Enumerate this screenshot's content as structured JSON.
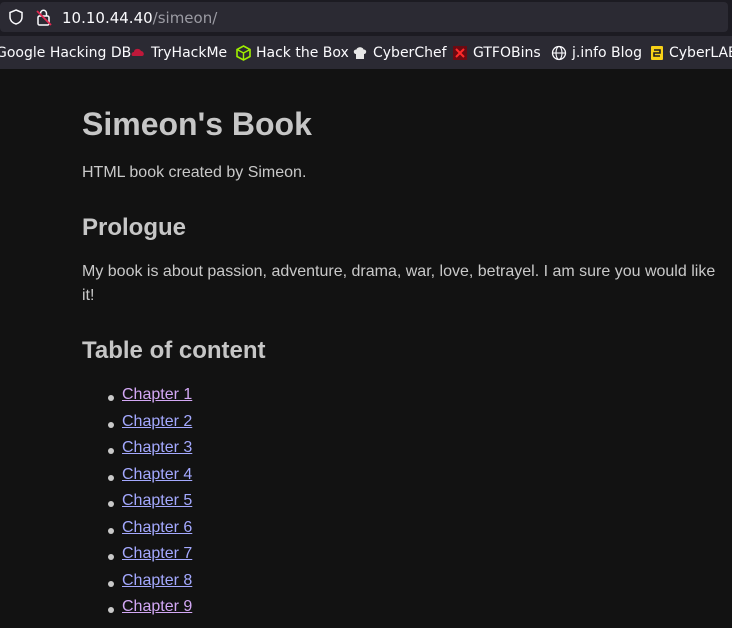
{
  "browser": {
    "url_host": "10.10.44.40",
    "url_path": "/simeon/",
    "bookmarks": [
      {
        "label": "Google Hacking DB",
        "icon": "none"
      },
      {
        "label": "TryHackMe",
        "icon": "tryhackme-icon"
      },
      {
        "label": "Hack the Box",
        "icon": "hackthebox-icon"
      },
      {
        "label": "CyberChef",
        "icon": "cyberchef-icon"
      },
      {
        "label": "GTFOBins",
        "icon": "gtfobins-icon"
      },
      {
        "label": "j.info Blog",
        "icon": "globe-icon"
      },
      {
        "label": "CyberLAB",
        "icon": "cyberlab-icon"
      }
    ]
  },
  "page": {
    "title": "Simeon's Book",
    "subtitle": "HTML book created by Simeon.",
    "prologue_heading": "Prologue",
    "prologue_text": "My book is about passion, adventure, drama, war, love, betrayel. I am sure you would like it!",
    "toc_heading": "Table of content",
    "chapters": [
      {
        "label": "Chapter 1",
        "visited": true
      },
      {
        "label": "Chapter 2",
        "visited": false
      },
      {
        "label": "Chapter 3",
        "visited": false
      },
      {
        "label": "Chapter 4",
        "visited": false
      },
      {
        "label": "Chapter 5",
        "visited": false
      },
      {
        "label": "Chapter 6",
        "visited": false
      },
      {
        "label": "Chapter 7",
        "visited": false
      },
      {
        "label": "Chapter 8",
        "visited": false
      },
      {
        "label": "Chapter 9",
        "visited": true
      }
    ]
  },
  "colors": {
    "background": "#121212",
    "link": "#a4a9ff",
    "visited_link": "#d3a8f5",
    "heading": "#c6c6c6"
  }
}
